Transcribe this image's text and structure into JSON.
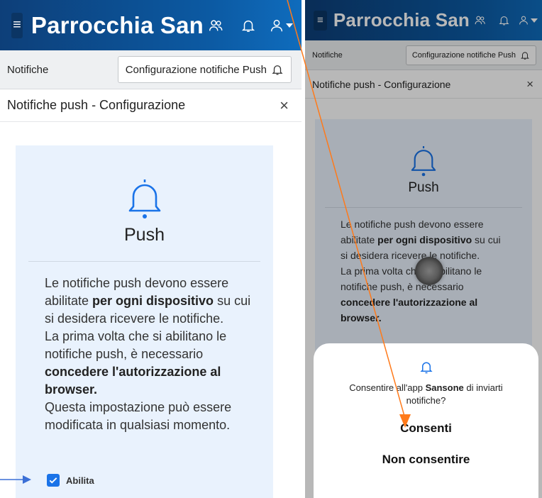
{
  "app": {
    "title": "Parrocchia San"
  },
  "subbar": {
    "label": "Notifiche",
    "config_button": "Configurazione notifiche Push"
  },
  "modal": {
    "title": "Notifiche push - Configurazione",
    "close": "×"
  },
  "card": {
    "heading": "Push",
    "desc_left": {
      "l1": "Le notifiche push devono essere",
      "l2a": "abilitate ",
      "l2b": "per ogni dispositivo",
      "l2c": " su cui",
      "l3": "si desidera ricevere le notifiche.",
      "l4": "La prima volta che si abilitano le",
      "l5": "notifiche push, è necessario",
      "l6": "concedere l'autorizzazione al",
      "l7": "browser.",
      "l8": "Questa impostazione può essere",
      "l9": "modificata in qualsiasi momento."
    },
    "desc_right": {
      "l1": "Le notifiche push devono essere",
      "l2a": "abilitate ",
      "l2b": "per ogni dispositivo",
      "l2c": " su cui",
      "l3": "si desidera ricevere le notifiche.",
      "l4": "La prima volta che si abilitano le",
      "l5": "notifiche push, è necessario",
      "l6": "concedere l'autorizzazione al",
      "l7": "browser."
    },
    "enable_label": "Abilita",
    "enable_checked": true
  },
  "permission_sheet": {
    "msg_before": "Consentire all'app ",
    "app_name": "Sansone",
    "msg_after": " di inviarti notifiche?",
    "allow": "Consenti",
    "deny": "Non consentire"
  },
  "icons": {
    "menu": "hamburger-icon",
    "users": "users-icon",
    "bell": "bell-icon",
    "account": "user-icon",
    "close": "close-icon",
    "check": "check-icon"
  },
  "colors": {
    "appbar": "#0c5aa3",
    "card_bg": "#e9f2fd",
    "accent_blue": "#1a73e8",
    "annotation_orange": "#ff7a1a",
    "annotation_blue": "#3b6fd6"
  }
}
